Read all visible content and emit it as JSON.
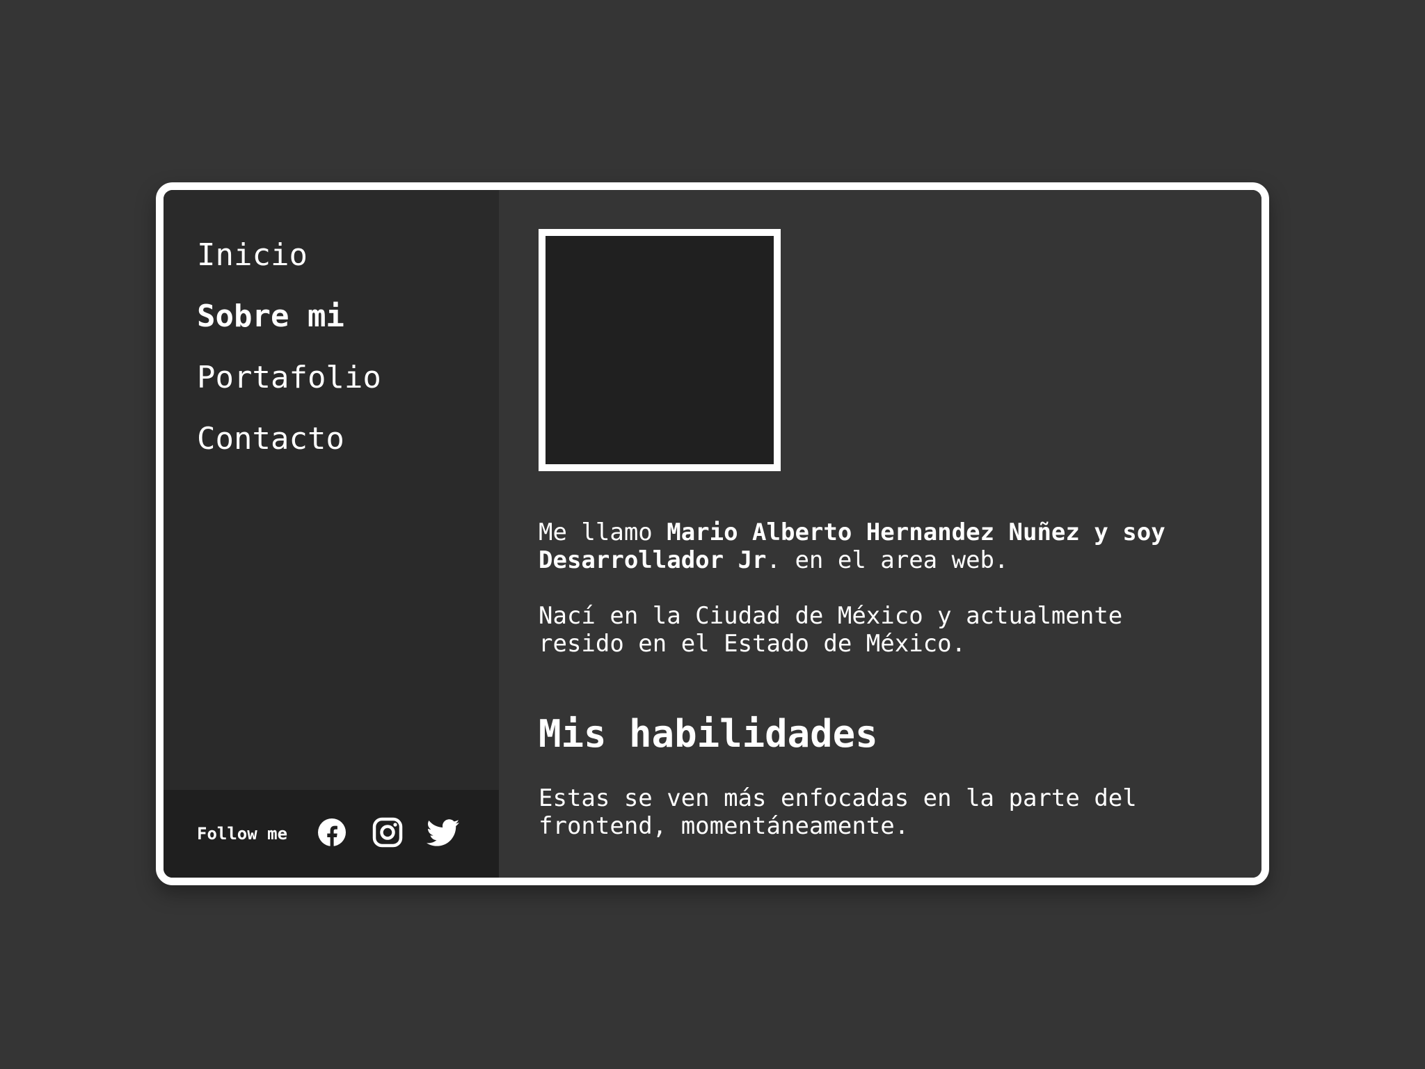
{
  "nav": {
    "items": [
      {
        "label": "Inicio"
      },
      {
        "label": "Sobre mi"
      },
      {
        "label": "Portafolio"
      },
      {
        "label": "Contacto"
      }
    ],
    "active": "Sobre mi"
  },
  "footer": {
    "follow_label": "Follow me",
    "social": [
      {
        "icon": "facebook-icon"
      },
      {
        "icon": "instagram-icon"
      },
      {
        "icon": "twitter-icon"
      }
    ]
  },
  "about": {
    "intro_prefix": "Me llamo ",
    "intro_name": "Mario Alberto Hernandez Nuñez y soy Desarrollador Jr",
    "intro_suffix": ". en el area web.",
    "origin": "Nací en la Ciudad de México y actualmente resido en el Estado de México.",
    "skills_title": "Mis habilidades",
    "skills_text": "Estas se ven más enfocadas en la parte del frontend, momentáneamente."
  },
  "colors": {
    "page_background": "#353535",
    "sidebar_background": "#2a2a2a",
    "footer_background": "#1f1f1f",
    "avatar_fill": "#202020",
    "border": "#ffffff",
    "text": "#ffffff"
  }
}
